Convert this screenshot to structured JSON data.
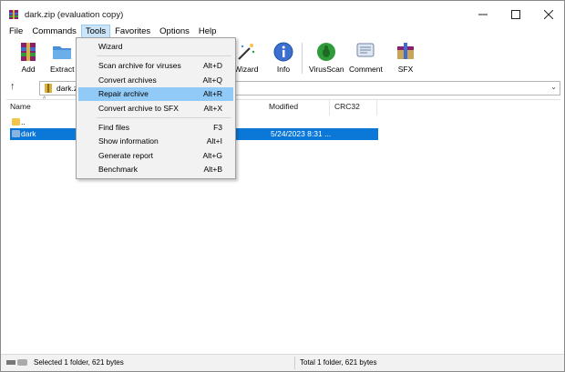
{
  "window": {
    "title": "dark.zip (evaluation copy)"
  },
  "menubar": [
    "File",
    "Commands",
    "Tools",
    "Favorites",
    "Options",
    "Help"
  ],
  "toolbar": {
    "add": "Add",
    "extract": "Extract",
    "wizard": "Wizard",
    "info": "Info",
    "virusscan": "VirusScan",
    "comment": "Comment",
    "sfx": "SFX"
  },
  "address": {
    "path": "dark.z"
  },
  "columns": {
    "name": "Name",
    "modified": "Modified",
    "crc": "CRC32"
  },
  "files": [
    {
      "name": "..",
      "modified": ""
    },
    {
      "name": "dark",
      "modified": "5/24/2023 8:31 ..."
    }
  ],
  "tools_menu": [
    {
      "label": "Wizard",
      "shortcut": ""
    },
    {
      "label": "Scan archive for viruses",
      "shortcut": "Alt+D"
    },
    {
      "label": "Convert archives",
      "shortcut": "Alt+Q"
    },
    {
      "label": "Repair archive",
      "shortcut": "Alt+R"
    },
    {
      "label": "Convert archive to SFX",
      "shortcut": "Alt+X"
    },
    {
      "label": "Find files",
      "shortcut": "F3"
    },
    {
      "label": "Show information",
      "shortcut": "Alt+I"
    },
    {
      "label": "Generate report",
      "shortcut": "Alt+G"
    },
    {
      "label": "Benchmark",
      "shortcut": "Alt+B"
    }
  ],
  "status": {
    "left": "Selected 1 folder, 621 bytes",
    "right": "Total 1 folder, 621 bytes"
  },
  "colors": {
    "selection": "#0b78d7",
    "menu_highlight": "#91c9f7"
  }
}
